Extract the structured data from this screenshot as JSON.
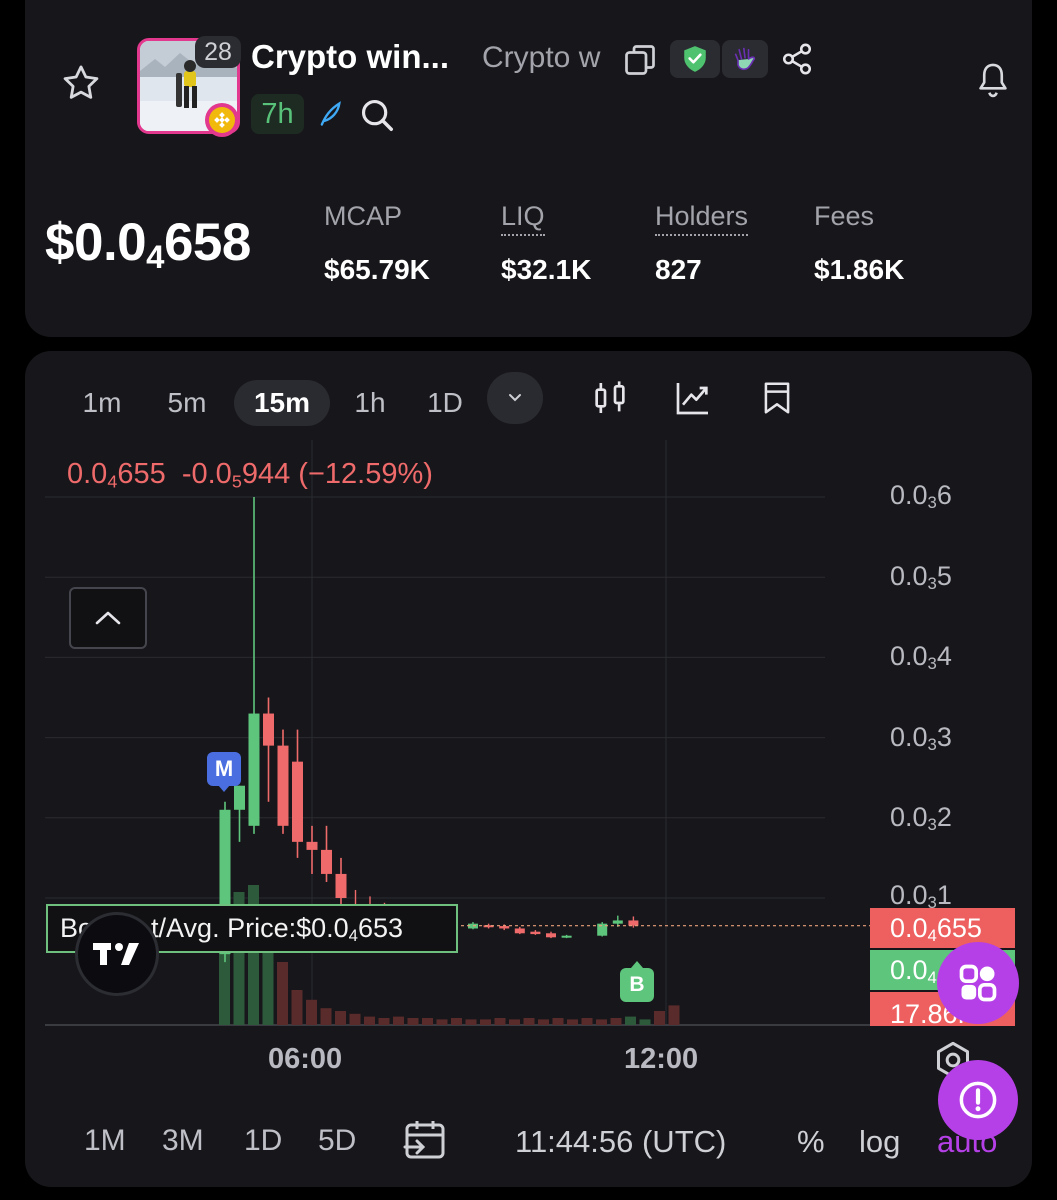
{
  "token": {
    "name": "Crypto win...",
    "ticker": "Crypto w",
    "age_badge": "28",
    "age": "7h"
  },
  "price": {
    "lead": "$0.0",
    "sub": "4",
    "tail": "658"
  },
  "stats": [
    {
      "label": "MCAP",
      "value": "$65.79K"
    },
    {
      "label": "LIQ",
      "value": "$32.1K"
    },
    {
      "label": "Holders",
      "value": "827"
    },
    {
      "label": "Fees",
      "value": "$1.86K"
    }
  ],
  "timeframes": [
    "1m",
    "5m",
    "15m",
    "1h",
    "1D"
  ],
  "active_timeframe": "15m",
  "ohlc": {
    "price_lead": "0.0",
    "price_sub": "4",
    "price_tail": "655",
    "change_lead": "-0.0",
    "change_sub": "5",
    "change_tail": "944",
    "change_pct": "(−12.59%)"
  },
  "yaxis": [
    {
      "lead": "0.0",
      "sub": "3",
      "tail": "6"
    },
    {
      "lead": "0.0",
      "sub": "3",
      "tail": "5"
    },
    {
      "lead": "0.0",
      "sub": "3",
      "tail": "4"
    },
    {
      "lead": "0.0",
      "sub": "3",
      "tail": "3"
    },
    {
      "lead": "0.0",
      "sub": "3",
      "tail": "2"
    },
    {
      "lead": "0.0",
      "sub": "3",
      "tail": "1"
    }
  ],
  "price_tags": {
    "last": {
      "lead": "0.0",
      "sub": "4",
      "tail": "655"
    },
    "avg": {
      "lead": "0.0",
      "sub": "4",
      "tail": ""
    },
    "volume": "17.86K"
  },
  "bought_label": {
    "prefix": "Bo",
    "text": "t/Avg. Price:$0.0",
    "sub": "4",
    "tail": "653"
  },
  "markers": {
    "m": "M",
    "b": "B"
  },
  "xaxis": [
    "06:00",
    "12:00"
  ],
  "ranges": [
    "1M",
    "3M",
    "1D",
    "5D"
  ],
  "clock": "11:44:56 (UTC)",
  "options": [
    "%",
    "log",
    "auto"
  ],
  "colors": {
    "up": "#5ec57c",
    "down": "#ef6a6a",
    "accent": "#b640e8",
    "avatar_border": "#e2388d"
  },
  "chart_data": {
    "type": "candlestick",
    "interval": "15m",
    "yaxis_ticks": [
      0.0006,
      0.0005,
      0.0004,
      0.0003,
      0.0002,
      0.0001
    ],
    "xaxis_ticks": [
      "06:00",
      "12:00"
    ],
    "last_price": 6.55e-05,
    "avg_price": 6.53e-05,
    "candles": [
      {
        "o": 3e-05,
        "h": 0.00022,
        "l": 2e-05,
        "c": 0.00021,
        "dir": "up"
      },
      {
        "o": 0.00021,
        "h": 0.00024,
        "l": 0.00017,
        "c": 0.00024,
        "dir": "up"
      },
      {
        "o": 0.00019,
        "h": 0.0006,
        "l": 0.00018,
        "c": 0.00033,
        "dir": "up"
      },
      {
        "o": 0.00033,
        "h": 0.00035,
        "l": 0.00022,
        "c": 0.00029,
        "dir": "down"
      },
      {
        "o": 0.00029,
        "h": 0.00031,
        "l": 0.00018,
        "c": 0.00019,
        "dir": "down"
      },
      {
        "o": 0.00027,
        "h": 0.00031,
        "l": 0.00015,
        "c": 0.00017,
        "dir": "down"
      },
      {
        "o": 0.00017,
        "h": 0.00019,
        "l": 0.00013,
        "c": 0.00016,
        "dir": "down"
      },
      {
        "o": 0.00016,
        "h": 0.00019,
        "l": 0.00012,
        "c": 0.00013,
        "dir": "down"
      },
      {
        "o": 0.00013,
        "h": 0.00015,
        "l": 9e-05,
        "c": 0.0001,
        "dir": "down"
      }
    ],
    "tail_candles": [
      {
        "o": 6.8e-05,
        "h": 7e-05,
        "l": 6.1e-05,
        "c": 6.2e-05,
        "dir": "up"
      },
      {
        "o": 6.6e-05,
        "h": 6.8e-05,
        "l": 6.2e-05,
        "c": 6.4e-05,
        "dir": "down"
      },
      {
        "o": 6.5e-05,
        "h": 6.7e-05,
        "l": 6e-05,
        "c": 6.2e-05,
        "dir": "down"
      },
      {
        "o": 6.2e-05,
        "h": 6.4e-05,
        "l": 5.5e-05,
        "c": 5.6e-05,
        "dir": "down"
      },
      {
        "o": 5.8e-05,
        "h": 6e-05,
        "l": 5.4e-05,
        "c": 5.5e-05,
        "dir": "down"
      },
      {
        "o": 5.6e-05,
        "h": 5.8e-05,
        "l": 5e-05,
        "c": 5.1e-05,
        "dir": "down"
      },
      {
        "o": 5.2e-05,
        "h": 5.4e-05,
        "l": 5e-05,
        "c": 5.3e-05,
        "dir": "up"
      },
      {
        "o": 5.3e-05,
        "h": 7e-05,
        "l": 5.2e-05,
        "c": 6.8e-05,
        "dir": "up"
      },
      {
        "o": 6.8e-05,
        "h": 7.8e-05,
        "l": 6.4e-05,
        "c": 7.2e-05,
        "dir": "up"
      },
      {
        "o": 7.2e-05,
        "h": 7.7e-05,
        "l": 6.3e-05,
        "c": 6.55e-05,
        "dir": "down"
      }
    ]
  }
}
